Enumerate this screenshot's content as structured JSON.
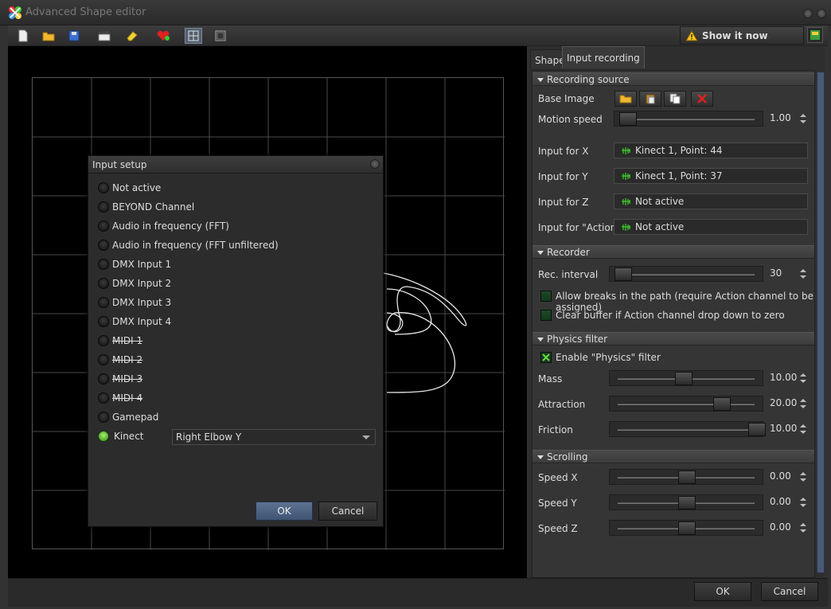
{
  "window": {
    "title": "Advanced Shape editor"
  },
  "toolbar": {
    "show_it_now": "Show it now"
  },
  "tabs": [
    {
      "label": "Shape"
    },
    {
      "label": "Input recording"
    }
  ],
  "recording_source": {
    "header": "Recording source",
    "base_image_label": "Base Image",
    "motion_speed_label": "Motion speed",
    "motion_speed_value": "1.00",
    "input_x_label": "Input for X",
    "input_x_value": "Kinect 1, Point: 44",
    "input_y_label": "Input for Y",
    "input_y_value": "Kinect 1, Point: 37",
    "input_z_label": "Input for Z",
    "input_z_value": "Not active",
    "input_action_label": "Input for \"Action\"",
    "input_action_value": "Not active"
  },
  "recorder": {
    "header": "Recorder",
    "rec_interval_label": "Rec. interval",
    "rec_interval_value": "30",
    "allow_breaks_label": "Allow breaks in the path (require Action channel to be assigned)",
    "clear_buffer_label": "Clear buffer if Action channel drop down to zero"
  },
  "physics": {
    "header": "Physics filter",
    "enable_label": "Enable \"Physics\" filter",
    "mass_label": "Mass",
    "mass_value": "10.00",
    "attraction_label": "Attraction",
    "attraction_value": "20.00",
    "friction_label": "Friction",
    "friction_value": "10.00"
  },
  "scrolling": {
    "header": "Scrolling",
    "speed_x_label": "Speed X",
    "speed_x_value": "0.00",
    "speed_y_label": "Speed Y",
    "speed_y_value": "0.00",
    "speed_z_label": "Speed Z",
    "speed_z_value": "0.00"
  },
  "footer": {
    "ok": "OK",
    "cancel": "Cancel"
  },
  "input_setup": {
    "title": "Input setup",
    "options": [
      {
        "label": "Not active",
        "strike": false
      },
      {
        "label": "BEYOND Channel",
        "strike": false
      },
      {
        "label": "Audio in frequency (FFT)",
        "strike": false
      },
      {
        "label": "Audio in frequency (FFT unfiltered)",
        "strike": false
      },
      {
        "label": "DMX Input 1",
        "strike": false
      },
      {
        "label": "DMX Input 2",
        "strike": false
      },
      {
        "label": "DMX Input 3",
        "strike": false
      },
      {
        "label": "DMX Input 4",
        "strike": false
      },
      {
        "label": "MIDI 1",
        "strike": true
      },
      {
        "label": "MIDI 2",
        "strike": true
      },
      {
        "label": "MIDI 3",
        "strike": true
      },
      {
        "label": "MIDI 4",
        "strike": true
      },
      {
        "label": "Gamepad",
        "strike": false
      },
      {
        "label": "Kinect",
        "strike": false,
        "selected": true
      }
    ],
    "kinect_selection": "Right Elbow Y",
    "ok": "OK",
    "cancel": "Cancel"
  },
  "colors": {
    "accent": "#4a5a76",
    "selected_radio": "#5ccb2a"
  }
}
